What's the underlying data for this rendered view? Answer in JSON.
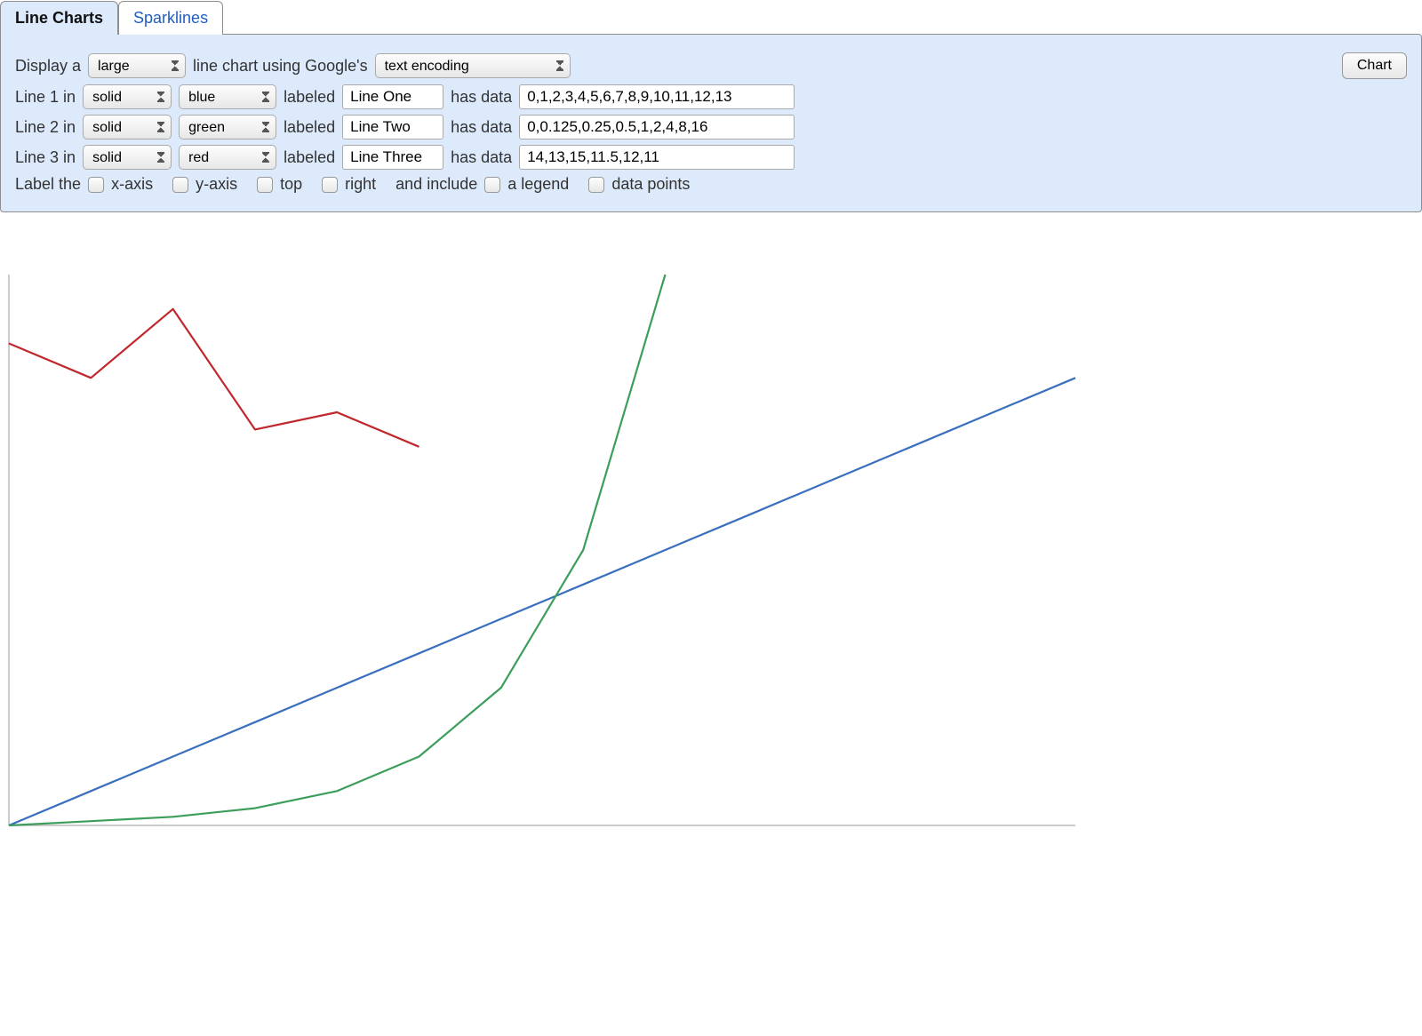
{
  "tabs": {
    "active": "Line Charts",
    "other": "Sparklines"
  },
  "row_display": {
    "prefix": "Display a",
    "size": "large",
    "middle": "line chart using Google's",
    "encoding": "text encoding",
    "chart_button": "Chart"
  },
  "lines": [
    {
      "prefix": "Line 1 in",
      "style": "solid",
      "color": "blue",
      "labeled": "labeled",
      "label_value": "Line One",
      "has_data": "has data",
      "data_value": "0,1,2,3,4,5,6,7,8,9,10,11,12,13"
    },
    {
      "prefix": "Line 2 in",
      "style": "solid",
      "color": "green",
      "labeled": "labeled",
      "label_value": "Line Two",
      "has_data": "has data",
      "data_value": "0,0.125,0.25,0.5,1,2,4,8,16"
    },
    {
      "prefix": "Line 3 in",
      "style": "solid",
      "color": "red",
      "labeled": "labeled",
      "label_value": "Line Three",
      "has_data": "has data",
      "data_value": "14,13,15,11.5,12,11"
    }
  ],
  "axis_row": {
    "prefix": "Label the",
    "xaxis": "x-axis",
    "yaxis": "y-axis",
    "top": "top",
    "right": "right",
    "and_include": "and include",
    "legend": "a legend",
    "datapoints": "data points"
  },
  "chart_data": {
    "type": "line",
    "title": "",
    "xlabel": "",
    "ylabel": "",
    "ylim": [
      0,
      16
    ],
    "series": [
      {
        "name": "Line One",
        "color": "#3a6fbf",
        "values": [
          0,
          1,
          2,
          3,
          4,
          5,
          6,
          7,
          8,
          9,
          10,
          11,
          12,
          13
        ]
      },
      {
        "name": "Line Two",
        "color": "#3d9e5b",
        "values": [
          0,
          0.125,
          0.25,
          0.5,
          1,
          2,
          4,
          8,
          16
        ]
      },
      {
        "name": "Line Three",
        "color": "#c1282d",
        "values": [
          14,
          13,
          15,
          11.5,
          12,
          11
        ]
      }
    ]
  }
}
